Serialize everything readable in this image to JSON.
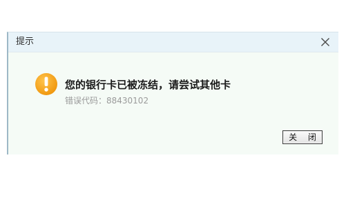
{
  "dialog": {
    "title": "提示",
    "close_icon": "close-icon",
    "warning_icon": "warning-icon",
    "message": "您的银行卡已被冻结，请尝试其他卡",
    "error_line": "错误代码：88430102",
    "close_button_label": "关 闭"
  },
  "colors": {
    "warning": "#f5a623",
    "title_bar": "#e8f3f9",
    "body_bg": "#f5fbf6",
    "error_text": "#9a9a9a"
  }
}
